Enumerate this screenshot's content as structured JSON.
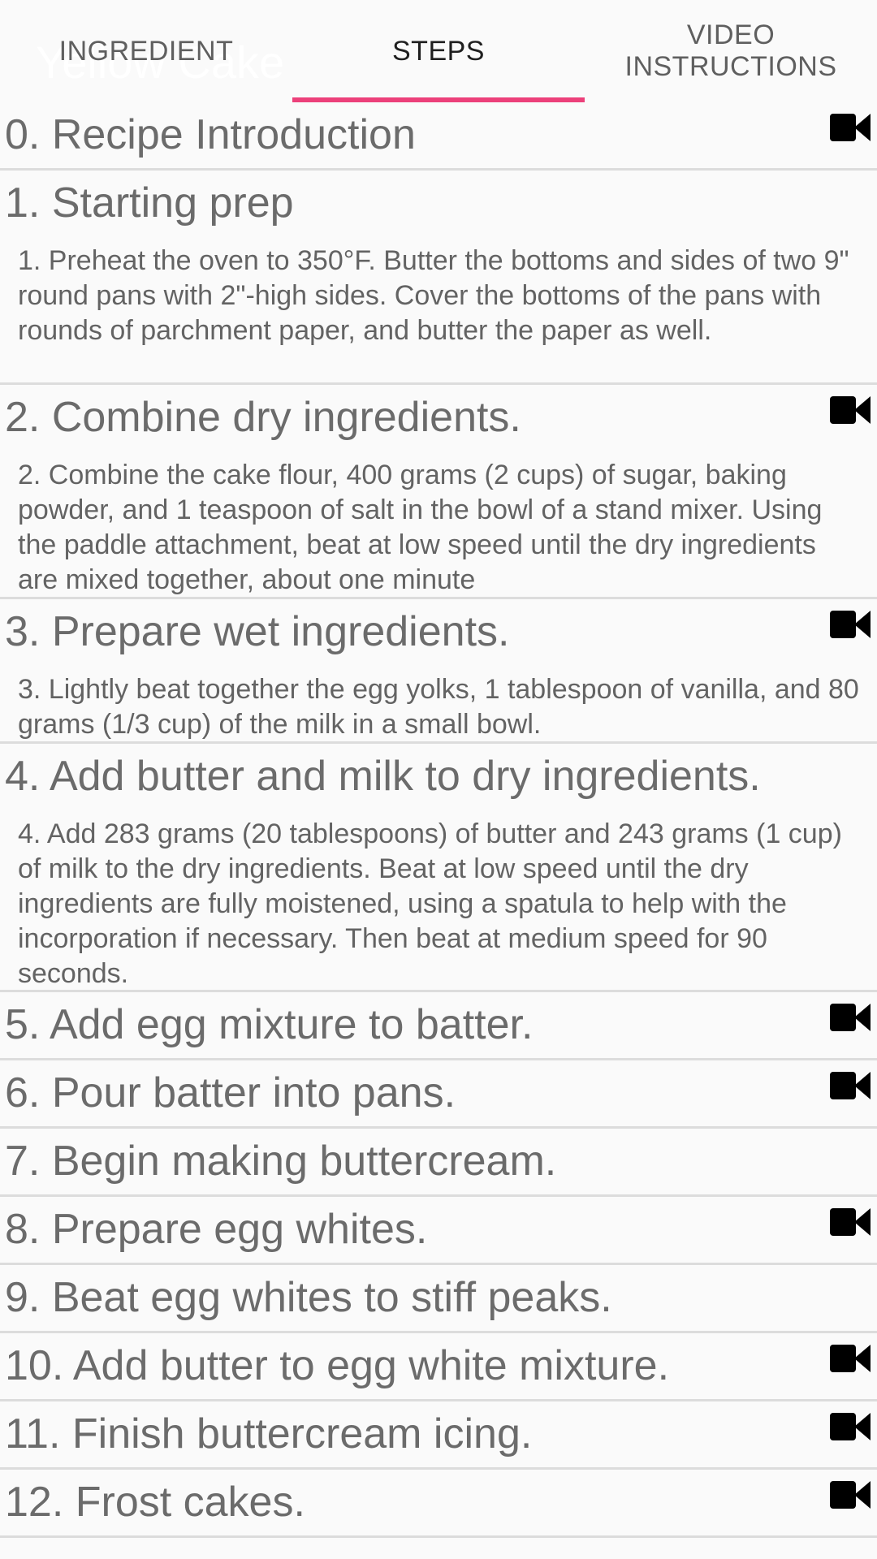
{
  "header": {
    "ghost_title": "Yellow Cake",
    "tabs": [
      {
        "label": "INGREDIENT",
        "active": false
      },
      {
        "label": "STEPS",
        "active": true
      },
      {
        "label": "VIDEO\nINSTRUCTIONS",
        "active": false
      }
    ],
    "accent_color": "#ec407a"
  },
  "steps": [
    {
      "title": "0. Recipe Introduction",
      "description": "",
      "has_video": true
    },
    {
      "title": "1. Starting prep",
      "description": "1. Preheat the oven to 350°F. Butter the bottoms and sides of two 9\" round pans with 2\"-high sides. Cover the bottoms of the pans with rounds of parchment paper, and butter the paper as well.",
      "has_video": false
    },
    {
      "title": "2. Combine dry ingredients.",
      "description": "2. Combine the cake flour, 400 grams (2 cups) of sugar, baking powder, and 1 teaspoon of salt in the bowl of a stand mixer. Using the paddle attachment, beat at low speed until the dry ingredients are mixed together, about one minute",
      "has_video": true
    },
    {
      "title": "3. Prepare wet ingredients.",
      "description": "3. Lightly beat together the egg yolks, 1 tablespoon of vanilla, and 80 grams (1/3 cup) of the milk in a small bowl.",
      "has_video": true
    },
    {
      "title": "4. Add butter and milk to dry ingredients.",
      "description": "4. Add 283 grams (20 tablespoons) of butter and 243 grams (1 cup) of milk to the dry ingredients. Beat at low speed until the dry ingredients are fully moistened, using a spatula to help with the incorporation if necessary. Then beat at medium speed for 90 seconds.",
      "has_video": false
    },
    {
      "title": "5. Add egg mixture to batter.",
      "description": "",
      "has_video": true
    },
    {
      "title": "6. Pour batter into pans.",
      "description": "",
      "has_video": true
    },
    {
      "title": "7. Begin making buttercream.",
      "description": "",
      "has_video": false
    },
    {
      "title": "8. Prepare egg whites.",
      "description": "",
      "has_video": true
    },
    {
      "title": "9. Beat egg whites to stiff peaks.",
      "description": "",
      "has_video": false
    },
    {
      "title": "10. Add butter to egg white mixture.",
      "description": "",
      "has_video": true
    },
    {
      "title": "11. Finish buttercream icing.",
      "description": "",
      "has_video": true
    },
    {
      "title": "12. Frost cakes.",
      "description": "",
      "has_video": true
    }
  ]
}
